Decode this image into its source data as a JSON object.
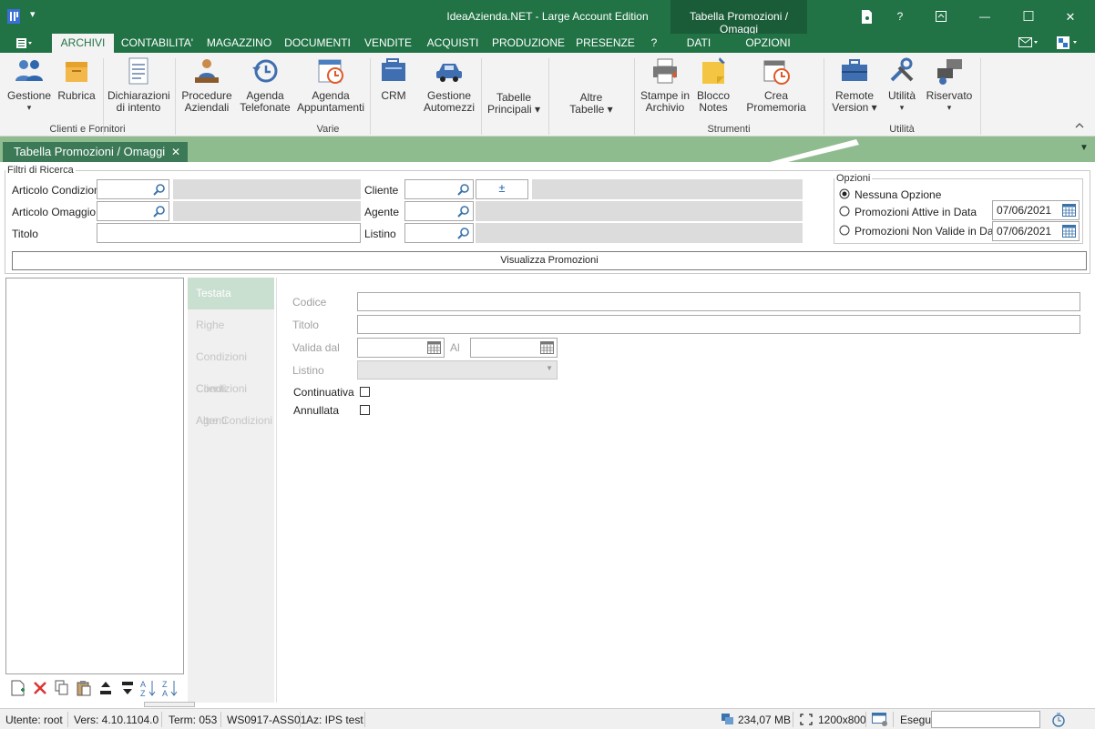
{
  "window": {
    "title": "IdeaAzienda.NET - Large Account Edition",
    "context_title": "Tabella Promozioni / Omaggi",
    "controls": {
      "minimize": "—",
      "maximize": "☐",
      "close": "✕",
      "help": "?"
    }
  },
  "menu_tabs": [
    "ARCHIVI",
    "CONTABILITA'",
    "MAGAZZINO",
    "DOCUMENTI",
    "VENDITE",
    "ACQUISTI",
    "PRODUZIONE",
    "PRESENZE",
    "?",
    "DATI",
    "OPZIONI"
  ],
  "ribbon": {
    "buttons": [
      {
        "label1": "Gestione",
        "label2": "▾",
        "icon": "people-icon"
      },
      {
        "label1": "Rubrica",
        "label2": "",
        "icon": "box-icon"
      },
      {
        "label1": "Dichiarazioni",
        "label2": "di intento",
        "icon": "document-icon"
      },
      {
        "label1": "Procedure",
        "label2": "Aziendali",
        "icon": "worker-icon"
      },
      {
        "label1": "Agenda",
        "label2": "Telefonate",
        "icon": "history-icon"
      },
      {
        "label1": "Agenda",
        "label2": "Appuntamenti",
        "icon": "calendar-clock-icon"
      },
      {
        "label1": "CRM",
        "label2": "",
        "icon": "briefcase-stack-icon"
      },
      {
        "label1": "Gestione",
        "label2": "Automezzi",
        "icon": "car-icon"
      },
      {
        "label1": "Tabelle",
        "label2": "Principali ▾",
        "icon": ""
      },
      {
        "label1": "Altre",
        "label2": "Tabelle ▾",
        "icon": ""
      },
      {
        "label1": "Stampe in",
        "label2": "Archivio",
        "icon": "printer-icon"
      },
      {
        "label1": "Blocco",
        "label2": "Notes",
        "icon": "sticky-note-icon"
      },
      {
        "label1": "Crea Promemoria",
        "label2": "",
        "icon": "reminder-icon"
      },
      {
        "label1": "Remote",
        "label2": "Version ▾",
        "icon": "toolbox-icon"
      },
      {
        "label1": "Utilità",
        "label2": "▾",
        "icon": "tools-icon"
      },
      {
        "label1": "Riservato",
        "label2": "▾",
        "icon": "servers-icon"
      }
    ],
    "groups": [
      "Clienti e Fornitori",
      "Varie",
      "Strumenti",
      "Utilità"
    ]
  },
  "doc_tab": {
    "label": "Tabella Promozioni / Omaggi",
    "close": "✕"
  },
  "filters": {
    "legend": "Filtri di Ricerca",
    "articolo_condizione": "Articolo Condizione",
    "articolo_omaggio": "Articolo Omaggio",
    "titolo": "Titolo",
    "cliente": "Cliente",
    "agente": "Agente",
    "listino": "Listino",
    "plus": "±"
  },
  "options": {
    "legend": "Opzioni",
    "nessuna": "Nessuna Opzione",
    "attive": "Promozioni Attive in Data",
    "non_valide": "Promozioni Non Valide in Data",
    "date1": "07/06/2021",
    "date2": "07/06/2021",
    "selected": "Nessuna Opzione"
  },
  "visualizza_button": "Visualizza Promozioni",
  "side_tabs": [
    "Testata",
    "Righe",
    "Condizioni Clienti",
    "Condizioni Agenti",
    "Altre Condizioni"
  ],
  "detail": {
    "codice": "Codice",
    "titolo": "Titolo",
    "valida_dal": "Valida dal",
    "al": "Al",
    "listino": "Listino",
    "continuativa": "Continuativa",
    "annullata": "Annullata"
  },
  "status": {
    "utente": "Utente: root",
    "versione": "Vers: 4.10.1104.0",
    "term": "Term: 053",
    "ws": "WS0917-ASS01",
    "az": "Az: IPS test",
    "memory": "234,07 MB",
    "resolution": "1200x800",
    "esegui": "Esegui"
  },
  "colors": {
    "accent": "#217346",
    "context": "#1a5c38",
    "doc_band": "#8fbc8f",
    "doc_tab": "#3c7a57"
  }
}
